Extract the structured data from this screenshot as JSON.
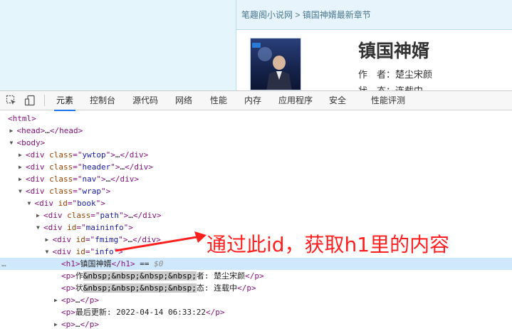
{
  "page": {
    "breadcrumb": {
      "site": "笔趣阁小说网",
      "separator": ">",
      "current": "镇国神婿最新章节"
    },
    "book_title": "镇国神婿",
    "author_label": "作　者：",
    "author": "楚尘宋颜",
    "status_label": "状　态：",
    "status": "连载中"
  },
  "devtools": {
    "tabs": [
      "元素",
      "控制台",
      "源代码",
      "网络",
      "性能",
      "内存",
      "应用程序",
      "安全",
      "性能评测"
    ],
    "active_tab": "元素",
    "dom_lines": [
      {
        "indent": 0,
        "tri": "",
        "tokens": [
          [
            "tg",
            "<html>"
          ]
        ]
      },
      {
        "indent": 1,
        "tri": "right",
        "tokens": [
          [
            "tg",
            "<head>"
          ],
          [
            "tx",
            "…"
          ],
          [
            "tg",
            "</head>"
          ]
        ]
      },
      {
        "indent": 1,
        "tri": "down",
        "tokens": [
          [
            "tg",
            "<body>"
          ]
        ]
      },
      {
        "indent": 2,
        "tri": "right",
        "tokens": [
          [
            "tg",
            "<div "
          ],
          [
            "an",
            "class"
          ],
          [
            "tg",
            "=\""
          ],
          [
            "av",
            "ywtop"
          ],
          [
            "tg",
            "\">"
          ],
          [
            "tx",
            "…"
          ],
          [
            "tg",
            "</div>"
          ]
        ]
      },
      {
        "indent": 2,
        "tri": "right",
        "tokens": [
          [
            "tg",
            "<div "
          ],
          [
            "an",
            "class"
          ],
          [
            "tg",
            "=\""
          ],
          [
            "av",
            "header"
          ],
          [
            "tg",
            "\">"
          ],
          [
            "tx",
            "…"
          ],
          [
            "tg",
            "</div>"
          ]
        ]
      },
      {
        "indent": 2,
        "tri": "right",
        "tokens": [
          [
            "tg",
            "<div "
          ],
          [
            "an",
            "class"
          ],
          [
            "tg",
            "=\""
          ],
          [
            "av",
            "nav"
          ],
          [
            "tg",
            "\">"
          ],
          [
            "tx",
            "…"
          ],
          [
            "tg",
            "</div>"
          ]
        ]
      },
      {
        "indent": 2,
        "tri": "down",
        "tokens": [
          [
            "tg",
            "<div "
          ],
          [
            "an",
            "class"
          ],
          [
            "tg",
            "=\""
          ],
          [
            "av",
            "wrap"
          ],
          [
            "tg",
            "\">"
          ]
        ]
      },
      {
        "indent": 3,
        "tri": "down",
        "tokens": [
          [
            "tg",
            "<div "
          ],
          [
            "an",
            "id"
          ],
          [
            "tg",
            "=\""
          ],
          [
            "av",
            "book"
          ],
          [
            "tg",
            "\">"
          ]
        ]
      },
      {
        "indent": 4,
        "tri": "right",
        "tokens": [
          [
            "tg",
            "<div "
          ],
          [
            "an",
            "class"
          ],
          [
            "tg",
            "=\""
          ],
          [
            "av",
            "path"
          ],
          [
            "tg",
            "\">"
          ],
          [
            "tx",
            "…"
          ],
          [
            "tg",
            "</div>"
          ]
        ]
      },
      {
        "indent": 4,
        "tri": "down",
        "tokens": [
          [
            "tg",
            "<div "
          ],
          [
            "an",
            "id"
          ],
          [
            "tg",
            "=\""
          ],
          [
            "av",
            "maininfo"
          ],
          [
            "tg",
            "\">"
          ]
        ]
      },
      {
        "indent": 5,
        "tri": "right",
        "tokens": [
          [
            "tg",
            "<div "
          ],
          [
            "an",
            "id"
          ],
          [
            "tg",
            "=\""
          ],
          [
            "av",
            "fmimg"
          ],
          [
            "tg",
            "\">"
          ],
          [
            "tx",
            "…"
          ],
          [
            "tg",
            "</div>"
          ]
        ]
      },
      {
        "indent": 5,
        "tri": "down",
        "tokens": [
          [
            "tg",
            "<div "
          ],
          [
            "an",
            "id"
          ],
          [
            "tg",
            "=\""
          ],
          [
            "av",
            "info"
          ],
          [
            "tg",
            "\">"
          ]
        ]
      },
      {
        "indent": 6,
        "tri": "",
        "selected": true,
        "tokens": [
          [
            "tg",
            "<h1>"
          ],
          [
            "tx",
            "镇国神婿"
          ],
          [
            "tg",
            "</h1>"
          ],
          [
            "tx",
            " == "
          ],
          [
            "em",
            "$0"
          ]
        ]
      },
      {
        "indent": 6,
        "tri": "",
        "tokens": [
          [
            "tg",
            "<p>"
          ],
          [
            "tx",
            "作"
          ],
          [
            "hl",
            "&nbsp;&nbsp;&nbsp;&nbsp;"
          ],
          [
            "tx",
            "者: 楚尘宋颜"
          ],
          [
            "tg",
            "</p>"
          ]
        ]
      },
      {
        "indent": 6,
        "tri": "",
        "tokens": [
          [
            "tg",
            "<p>"
          ],
          [
            "tx",
            "状"
          ],
          [
            "hl",
            "&nbsp;&nbsp;&nbsp;&nbsp;"
          ],
          [
            "tx",
            "态: 连载中"
          ],
          [
            "tg",
            "</p>"
          ]
        ]
      },
      {
        "indent": 6,
        "tri": "right",
        "tokens": [
          [
            "tg",
            "<p>"
          ],
          [
            "tx",
            "…"
          ],
          [
            "tg",
            "</p>"
          ]
        ]
      },
      {
        "indent": 6,
        "tri": "",
        "tokens": [
          [
            "tg",
            "<p>"
          ],
          [
            "tx",
            "最后更新: 2022-04-14 06:33:22"
          ],
          [
            "tg",
            "</p>"
          ]
        ]
      },
      {
        "indent": 6,
        "tri": "right",
        "tokens": [
          [
            "tg",
            "<p>"
          ],
          [
            "tx",
            "…"
          ],
          [
            "tg",
            "</p>"
          ]
        ]
      }
    ],
    "selected_dots": "…"
  },
  "annotation": {
    "text": "通过此id，获取h1里的内容",
    "color": "#ff1f1f"
  },
  "colors": {
    "tag": "#881280",
    "attr_name": "#994500",
    "attr_value": "#1a1aa6",
    "selected_bg": "#cfe8fc",
    "accent": "#1a73e8"
  }
}
